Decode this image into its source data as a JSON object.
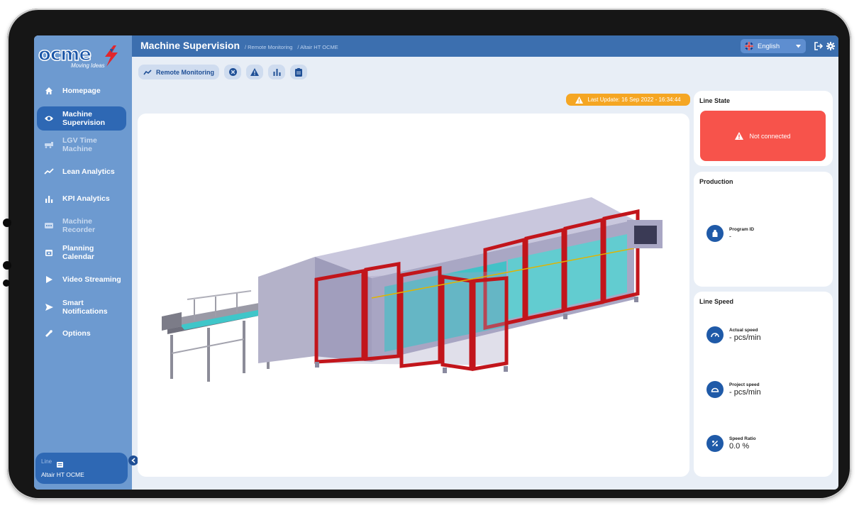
{
  "app": {
    "logo_text": "ocme",
    "logo_tagline": "Moving Ideas",
    "page_title": "Machine Supervision",
    "breadcrumb": [
      "/ Remote Monitoring",
      "/ Altair HT OCME"
    ]
  },
  "header": {
    "language": "English",
    "icons": [
      "flag-uk-icon",
      "chevron-down-icon",
      "logout-icon",
      "gear-icon"
    ]
  },
  "sidebar": {
    "items": [
      {
        "label": "Homepage",
        "icon": "home-icon",
        "active": false,
        "disabled": false
      },
      {
        "label": "Machine Supervision",
        "icon": "eye-icon",
        "active": true,
        "disabled": false
      },
      {
        "label": "LGV Time Machine",
        "icon": "lgv-icon",
        "active": false,
        "disabled": true
      },
      {
        "label": "Lean Analytics",
        "icon": "trend-icon",
        "active": false,
        "disabled": false
      },
      {
        "label": "KPI Analytics",
        "icon": "bar-chart-icon",
        "active": false,
        "disabled": false
      },
      {
        "label": "Machine Recorder",
        "icon": "recorder-icon",
        "active": false,
        "disabled": true
      },
      {
        "label": "Planning Calendar",
        "icon": "calendar-icon",
        "active": false,
        "disabled": false
      },
      {
        "label": "Video Streaming",
        "icon": "play-icon",
        "active": false,
        "disabled": false
      },
      {
        "label": "Smart Notifications",
        "icon": "send-icon",
        "active": false,
        "disabled": false
      },
      {
        "label": "Options",
        "icon": "wrench-icon",
        "active": false,
        "disabled": false
      }
    ],
    "line_label": "Line",
    "line_value": "Altair HT OCME"
  },
  "toolbar": {
    "remote_monitoring": "Remote Monitoring",
    "icons": [
      "trend-icon",
      "close-circle-icon",
      "warning-icon",
      "bar-chart-icon",
      "clipboard-icon"
    ]
  },
  "status": {
    "last_update": "Last Update: 16 Sep 2022 - 16:34:44"
  },
  "line_state": {
    "title": "Line State",
    "value": "Not connected"
  },
  "production": {
    "title": "Production",
    "program_id_label": "Program ID",
    "program_id_value": "-"
  },
  "line_speed": {
    "title": "Line Speed",
    "actual_label": "Actual speed",
    "actual_value": "- pcs/min",
    "project_label": "Project speed",
    "project_value": "- pcs/min",
    "ratio_label": "Speed Ratio",
    "ratio_value": "0.0 %"
  },
  "colors": {
    "sidebar": "#6d9ad0",
    "active": "#2e68b4",
    "topbar": "#3c6faf",
    "alert": "#f7534b",
    "warning": "#f5a623"
  }
}
